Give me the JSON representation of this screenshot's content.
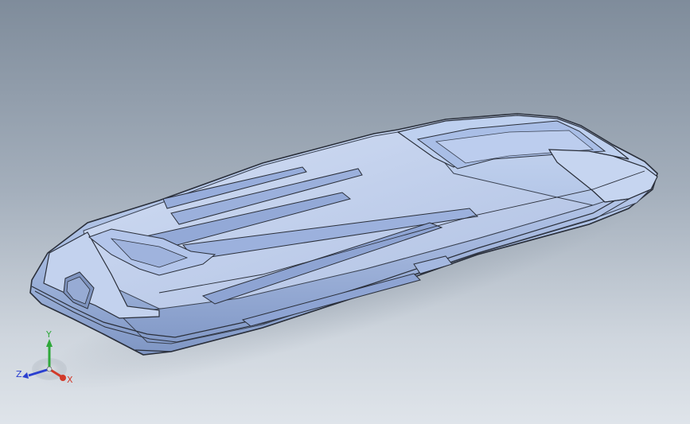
{
  "viewport": {
    "background_top": "#7f8c9b",
    "background_bottom": "#dfe4ea"
  },
  "model": {
    "body_color": "#b4c6e6",
    "shade_color": "#8fa6cf",
    "edge_color": "#2a2f3a"
  },
  "triad": {
    "x_label": "X",
    "y_label": "Y",
    "z_label": "Z",
    "x_color": "#d23a2a",
    "y_color": "#2fa83a",
    "z_color": "#2a3fd0"
  }
}
